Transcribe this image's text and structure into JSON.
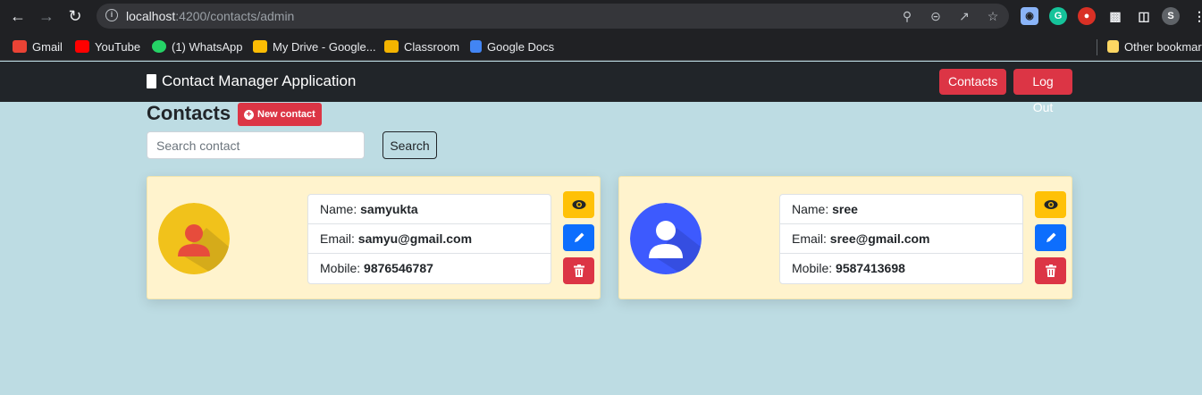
{
  "browser": {
    "url_host": "localhost",
    "url_path": ":4200/contacts/admin",
    "profile_initial": "S",
    "bookmarks": [
      {
        "label": "Gmail",
        "color": "#ea4335"
      },
      {
        "label": "YouTube",
        "color": "#ff0000"
      },
      {
        "label": "(1) WhatsApp",
        "color": "#25d366"
      },
      {
        "label": "My Drive - Google...",
        "color": "#fbbc04"
      },
      {
        "label": "Classroom",
        "color": "#f4b400"
      },
      {
        "label": "Google Docs",
        "color": "#4285f4"
      }
    ],
    "other_bookmarks": "Other bookmarks"
  },
  "nav": {
    "brand": "Contact Manager Application",
    "contacts_btn": "Contacts",
    "logout_btn": "Log Out"
  },
  "page": {
    "title": "Contacts",
    "new_contact": "New contact",
    "search_placeholder": "Search contact",
    "search_btn": "Search"
  },
  "contacts": [
    {
      "name_label": "Name:",
      "name": "samyukta",
      "email_label": "Email:",
      "email": "samyu@gmail.com",
      "mobile_label": "Mobile:",
      "mobile": "9876546787",
      "avatar_color": "#f1c21b"
    },
    {
      "name_label": "Name:",
      "name": "sree",
      "email_label": "Email:",
      "email": "sree@gmail.com",
      "mobile_label": "Mobile:",
      "mobile": "9587413698",
      "avatar_color": "#3d5afe"
    }
  ],
  "colors": {
    "accent_red": "#dc3545",
    "view_yellow": "#ffc107",
    "edit_blue": "#0d6efd",
    "background": "#bddce3"
  }
}
